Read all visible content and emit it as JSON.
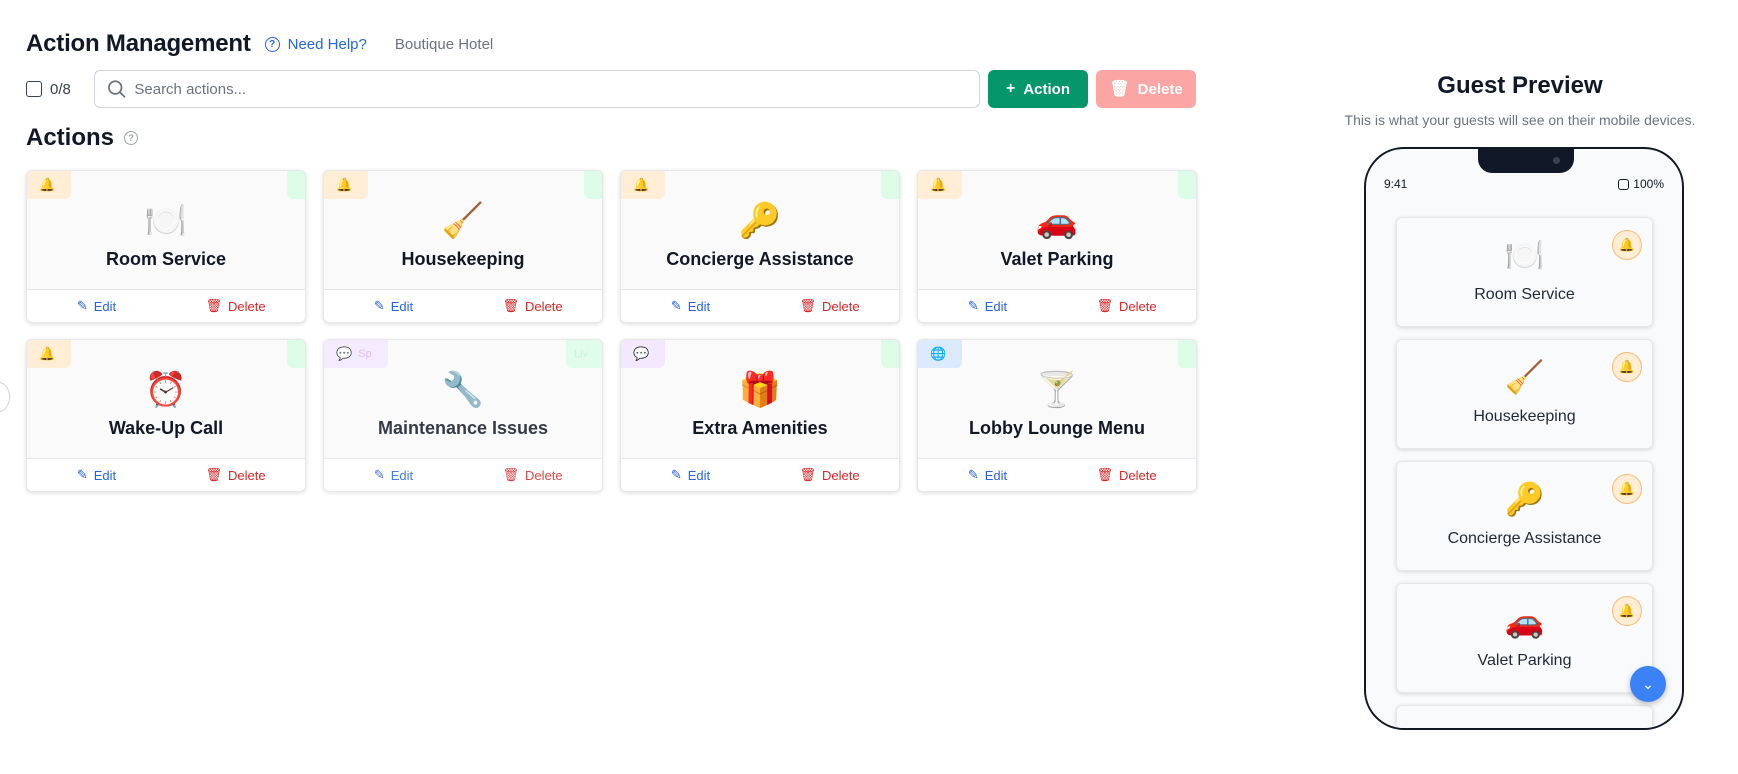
{
  "header": {
    "title": "Action Management",
    "help_label": "Need Help?",
    "hotel_name": "Boutique Hotel"
  },
  "toolbar": {
    "selection_count": "0/8",
    "search_placeholder": "Search actions...",
    "add_label": "Action",
    "delete_label": "Delete"
  },
  "actions_section": {
    "title": "Actions"
  },
  "cards": [
    {
      "name": "Room Service",
      "emoji": "🍽️",
      "badge": "bell-icon",
      "edit": "Edit",
      "delete": "Delete"
    },
    {
      "name": "Housekeeping",
      "emoji": "🧹",
      "badge": "bell-icon",
      "edit": "Edit",
      "delete": "Delete"
    },
    {
      "name": "Concierge Assistance",
      "emoji": "🔑",
      "badge": "bell-icon",
      "edit": "Edit",
      "delete": "Delete"
    },
    {
      "name": "Valet Parking",
      "emoji": "🚗",
      "badge": "bell-icon",
      "edit": "Edit",
      "delete": "Delete"
    },
    {
      "name": "Wake-Up Call",
      "emoji": "⏰",
      "badge": "bell-icon",
      "edit": "Edit",
      "delete": "Delete"
    },
    {
      "name": "Maintenance Issues",
      "emoji": "🔧",
      "badge": "chat-icon",
      "badge_text": "Sp",
      "right_text": "Liv",
      "edit": "Edit",
      "delete": "Delete"
    },
    {
      "name": "Extra Amenities",
      "emoji": "🎁",
      "badge": "chat-icon",
      "edit": "Edit",
      "delete": "Delete"
    },
    {
      "name": "Lobby Lounge Menu",
      "emoji": "🍸",
      "badge": "globe-icon",
      "edit": "Edit",
      "delete": "Delete"
    }
  ],
  "preview": {
    "title": "Guest Preview",
    "subtitle": "This is what your guests will see on their mobile devices.",
    "time": "9:41",
    "battery": "100%",
    "items": [
      {
        "name": "Room Service",
        "emoji": "🍽️"
      },
      {
        "name": "Housekeeping",
        "emoji": "🧹"
      },
      {
        "name": "Concierge Assistance",
        "emoji": "🔑"
      },
      {
        "name": "Valet Parking",
        "emoji": "🚗"
      }
    ]
  },
  "colors": {
    "primary_green": "#059669",
    "delete_disabled": "#fca5a5",
    "link_blue": "#2563eb",
    "danger_red": "#dc2626",
    "bell_orange": "#f97316"
  }
}
